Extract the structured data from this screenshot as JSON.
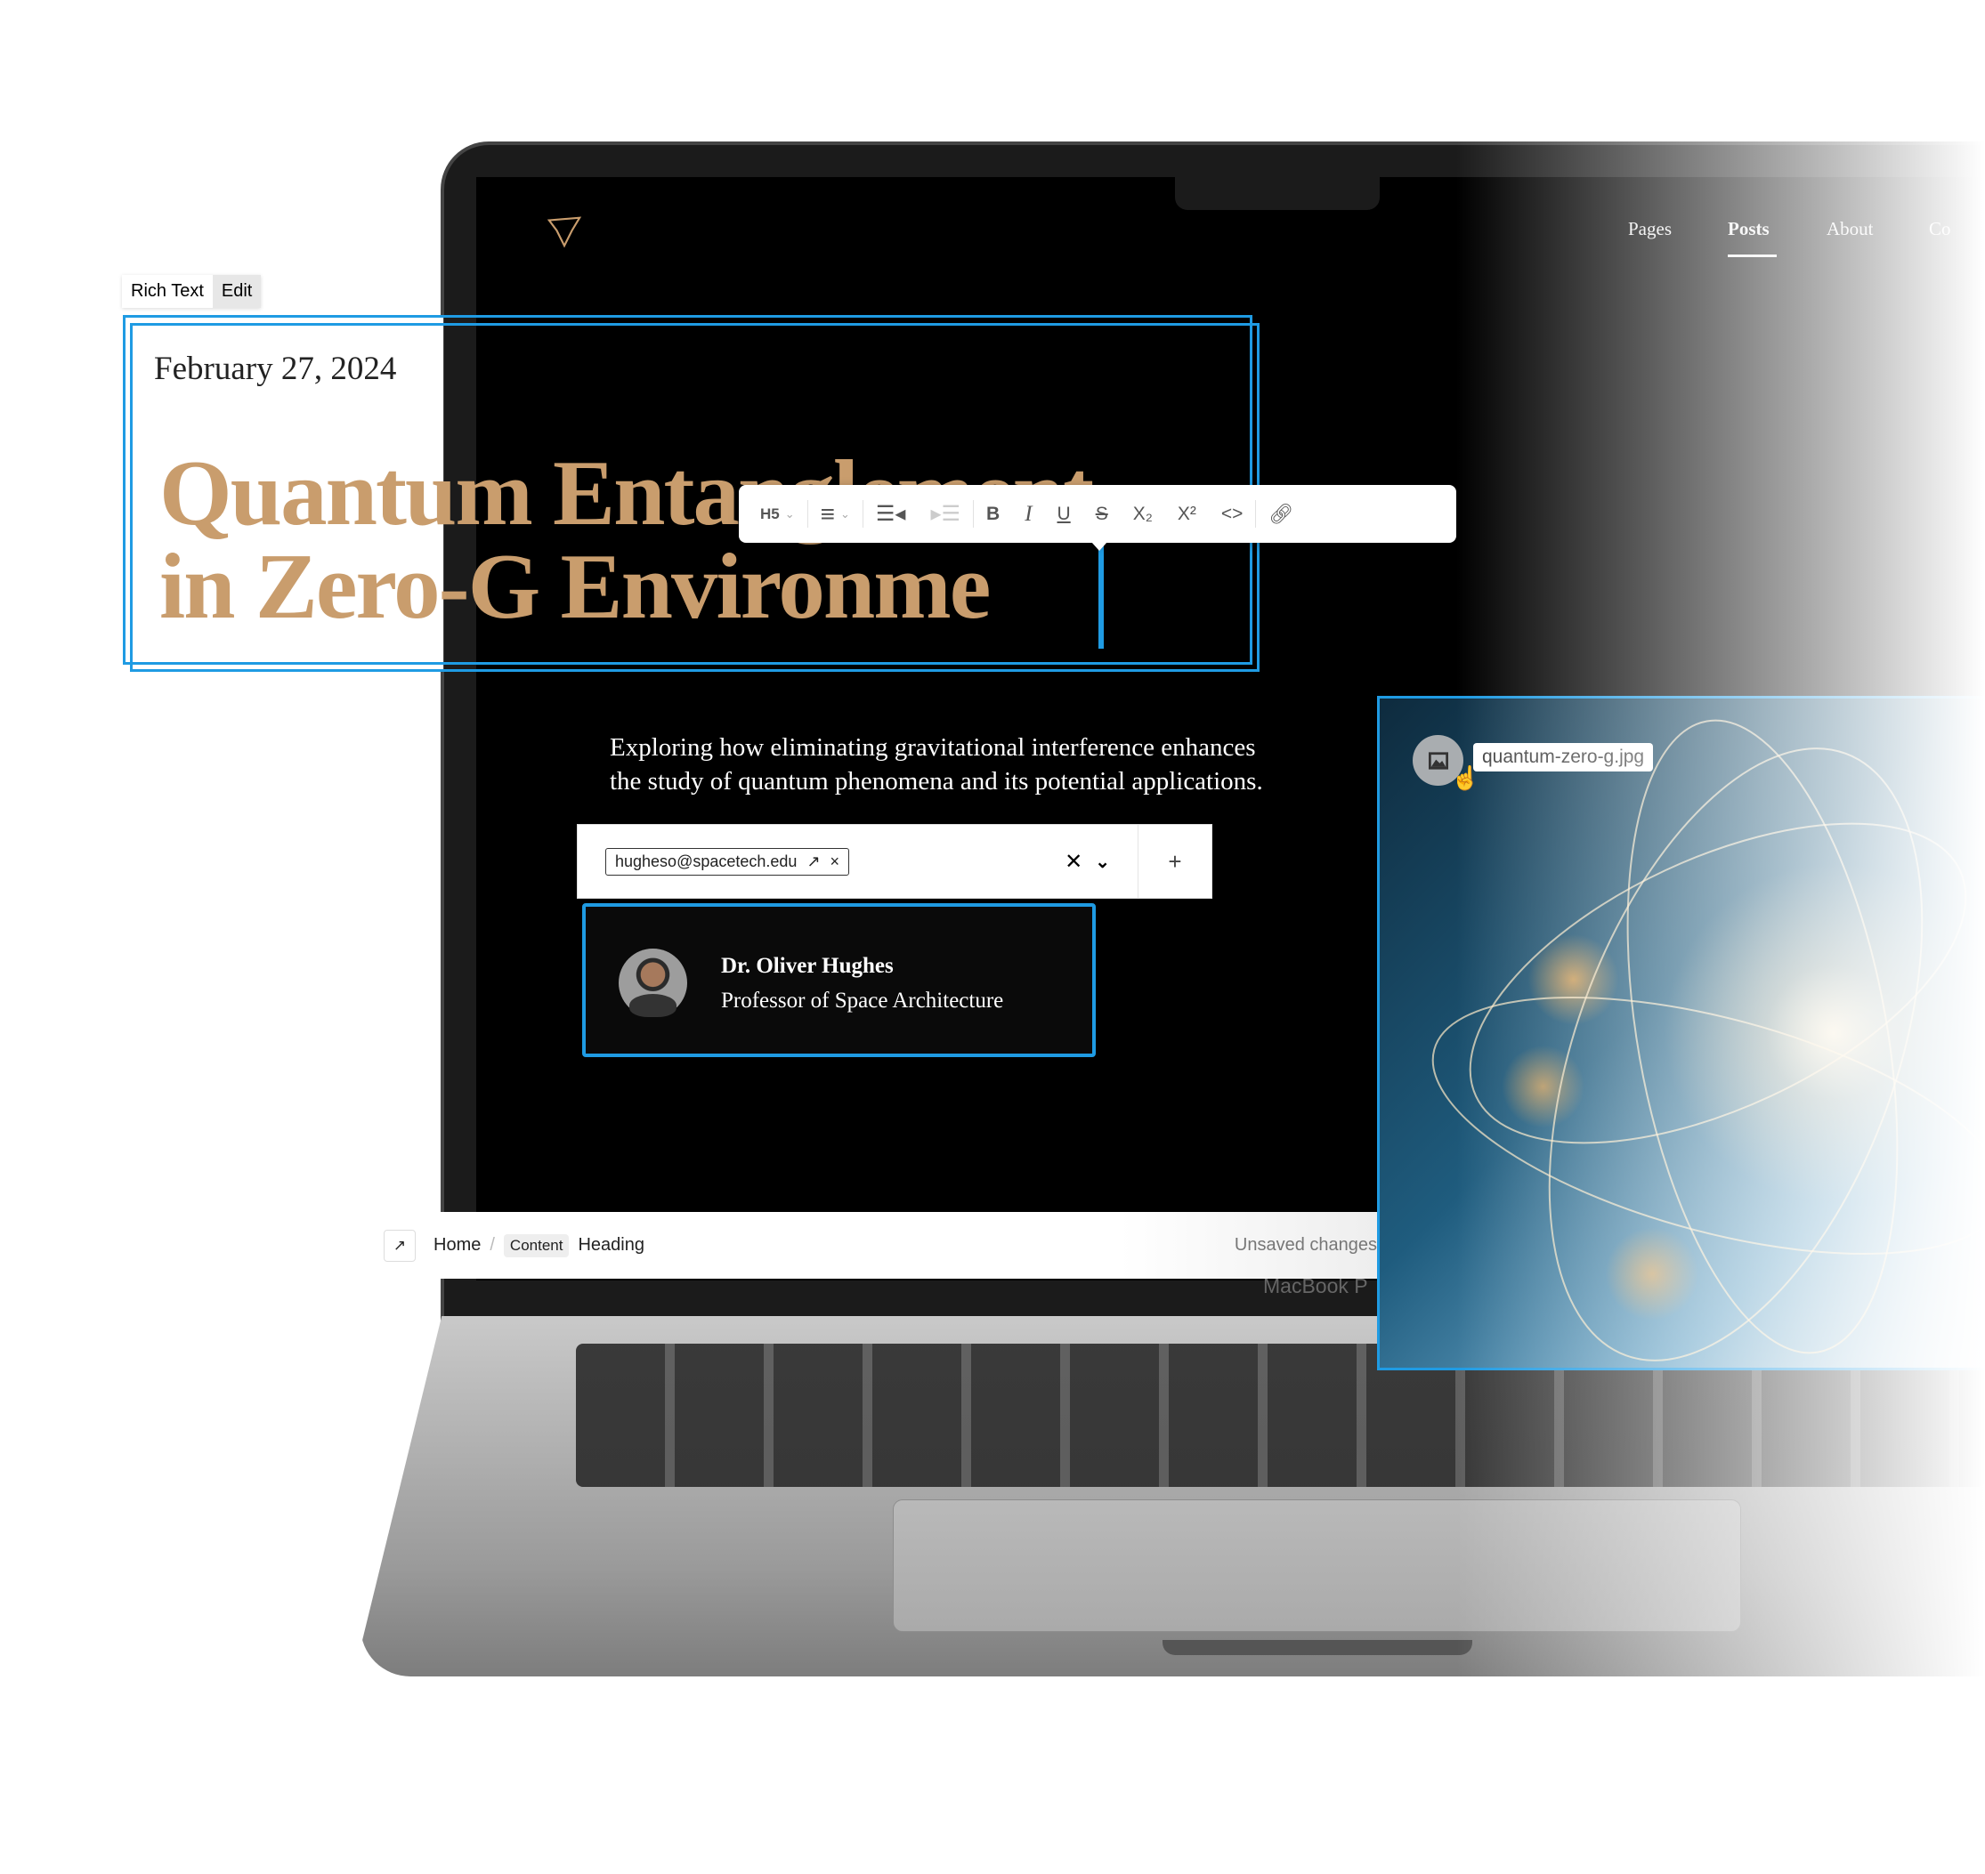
{
  "site": {
    "logo_icon": "star-outline-icon",
    "nav": [
      {
        "label": "Pages",
        "active": false
      },
      {
        "label": "Posts",
        "active": true
      },
      {
        "label": "About",
        "active": false
      },
      {
        "label": "Co",
        "active": false
      }
    ]
  },
  "block_label": {
    "type": "Rich Text",
    "action": "Edit"
  },
  "article": {
    "date": "February 27, 2024",
    "heading_line1": "Quantum Entanglement",
    "heading_line2": "in Zero-G Environme",
    "subtitle": "Exploring how eliminating gravitational interference enhances the study of quantum phenomena and its potential applications."
  },
  "toolbar": {
    "heading_level": "H5",
    "buttons": [
      "align",
      "indent",
      "outdent",
      "B",
      "I",
      "U",
      "S",
      "X₂",
      "X²",
      "<>",
      "link"
    ]
  },
  "author_field": {
    "email": "hugheso@spacetech.edu",
    "add_label": "+"
  },
  "author": {
    "name": "Dr. Oliver Hughes",
    "title": "Professor of Space Architecture"
  },
  "image": {
    "filename": "quantum-zero-g.jpg"
  },
  "breadcrumb": {
    "items": [
      "Home",
      "/",
      "Content",
      "Heading"
    ],
    "status": "Unsaved changes"
  },
  "device_label": "MacBook P",
  "colors": {
    "accent": "#1f9be3",
    "heading": "#c99d6d"
  }
}
